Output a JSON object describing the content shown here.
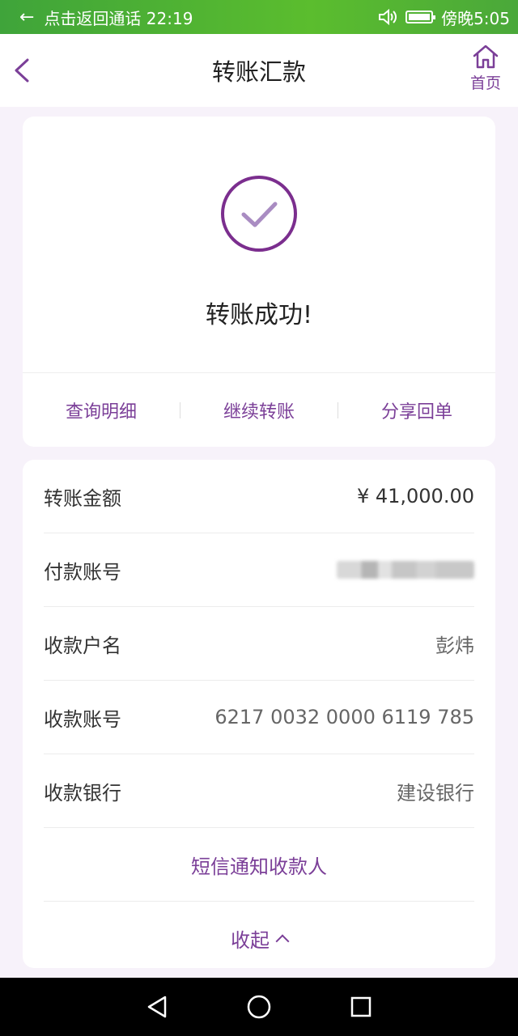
{
  "status_bar": {
    "call_text": "点击返回通话 22:19",
    "time_text": "傍晚5:05",
    "icons": [
      "back-arrow-icon",
      "volume-icon",
      "battery-icon"
    ]
  },
  "nav": {
    "title": "转账汇款",
    "home_label": "首页"
  },
  "success": {
    "message": "转账成功!",
    "actions": [
      "查询明细",
      "继续转账",
      "分享回单"
    ]
  },
  "details": {
    "rows": [
      {
        "label": "转账金额",
        "value": "¥ 41,000.00"
      },
      {
        "label": "付款账号",
        "value": ""
      },
      {
        "label": "收款户名",
        "value": "彭炜"
      },
      {
        "label": "收款账号",
        "value": "6217 0032 0000 6119 785"
      },
      {
        "label": "收款银行",
        "value": "建设银行"
      }
    ],
    "sms_notify_label": "短信通知收款人",
    "collapse_label": "收起"
  },
  "colors": {
    "accent": "#7b3f98",
    "status_bar": "#4aa83a",
    "background": "#f7f2fa"
  }
}
